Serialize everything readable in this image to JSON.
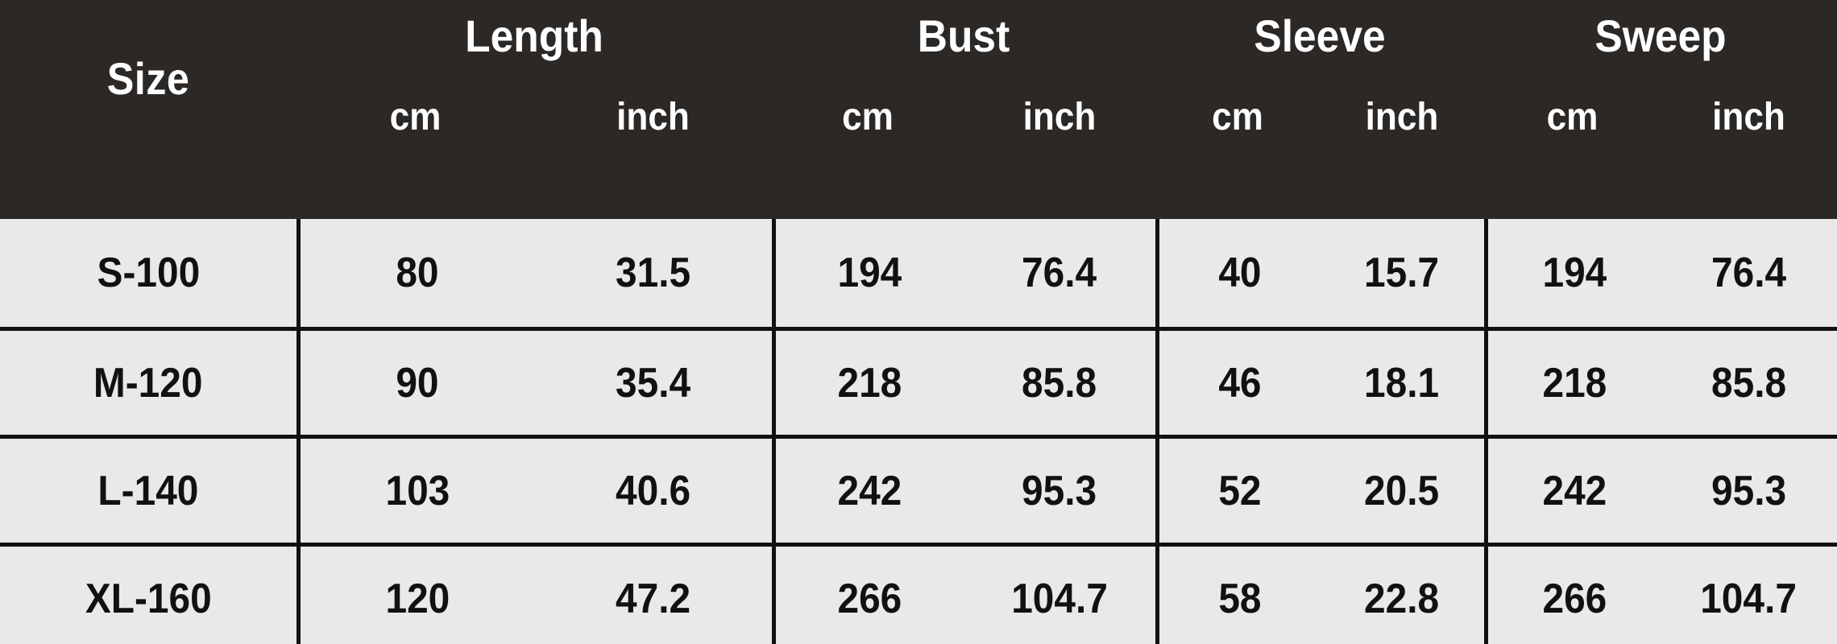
{
  "table": {
    "size_header": "Size",
    "groups": [
      {
        "name": "Length",
        "units": [
          "cm",
          "inch"
        ]
      },
      {
        "name": "Bust",
        "units": [
          "cm",
          "inch"
        ]
      },
      {
        "name": "Sleeve",
        "units": [
          "cm",
          "inch"
        ]
      },
      {
        "name": "Sweep",
        "units": [
          "cm",
          "inch"
        ]
      }
    ],
    "rows": [
      {
        "size": "S-100",
        "length_cm": "80",
        "length_inch": "31.5",
        "bust_cm": "194",
        "bust_inch": "76.4",
        "sleeve_cm": "40",
        "sleeve_inch": "15.7",
        "sweep_cm": "194",
        "sweep_inch": "76.4"
      },
      {
        "size": "M-120",
        "length_cm": "90",
        "length_inch": "35.4",
        "bust_cm": "218",
        "bust_inch": "85.8",
        "sleeve_cm": "46",
        "sleeve_inch": "18.1",
        "sweep_cm": "218",
        "sweep_inch": "85.8"
      },
      {
        "size": "L-140",
        "length_cm": "103",
        "length_inch": "40.6",
        "bust_cm": "242",
        "bust_inch": "95.3",
        "sleeve_cm": "52",
        "sleeve_inch": "20.5",
        "sweep_cm": "242",
        "sweep_inch": "95.3"
      },
      {
        "size": "XL-160",
        "length_cm": "120",
        "length_inch": "47.2",
        "bust_cm": "266",
        "bust_inch": "104.7",
        "sleeve_cm": "58",
        "sleeve_inch": "22.8",
        "sweep_cm": "266",
        "sweep_inch": "104.7"
      }
    ]
  },
  "colors": {
    "header_bg": "#2b2826",
    "header_text": "#ffffff",
    "cell_bg": "#e9e9e9",
    "cell_text": "#111111",
    "grid_line": "#111111"
  }
}
